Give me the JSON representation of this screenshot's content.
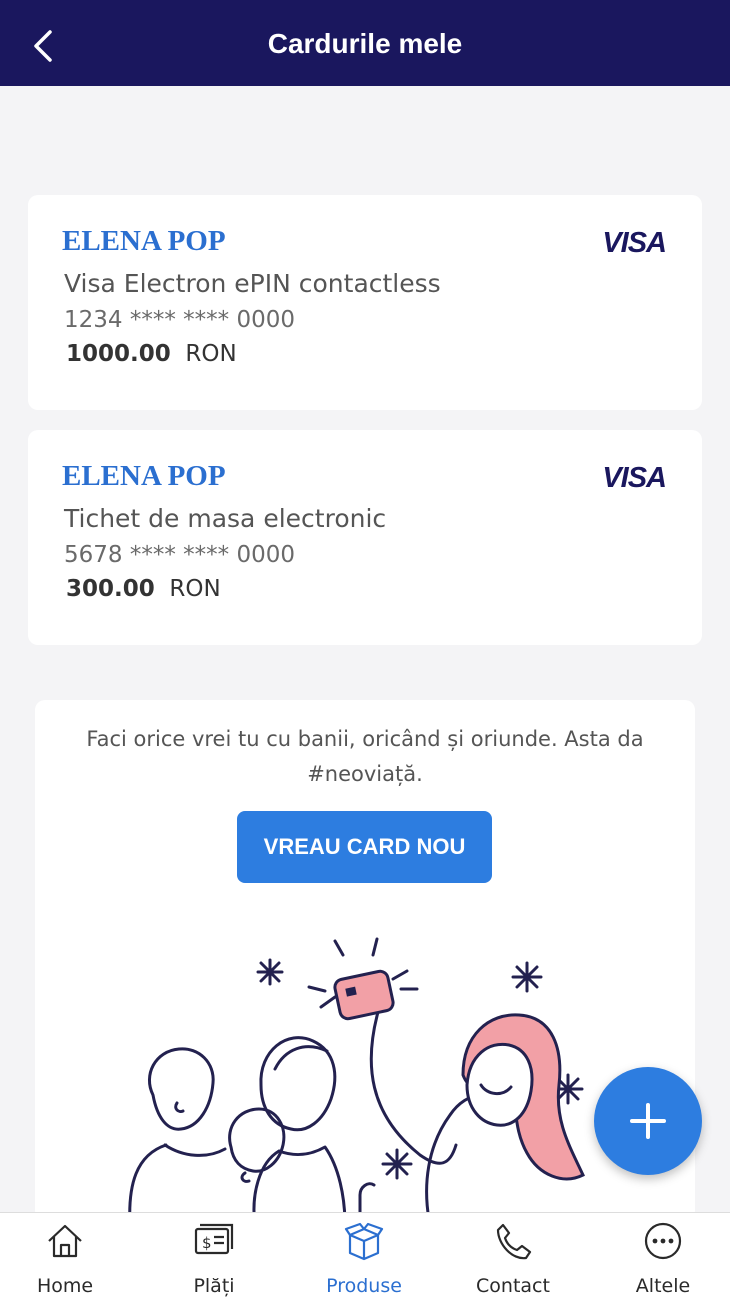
{
  "header": {
    "title": "Cardurile mele"
  },
  "cards": [
    {
      "holder": "ELENA POP",
      "network": "VISA",
      "type": "Visa Electron ePIN contactless",
      "number": "1234 **** **** 0000",
      "balance": "1000.00",
      "currency": "RON"
    },
    {
      "holder": "ELENA POP",
      "network": "VISA",
      "type": "Tichet de masa electronic",
      "number": "5678 **** **** 0000",
      "balance": "300.00",
      "currency": "RON"
    }
  ],
  "promo": {
    "text": "Faci orice vrei tu cu banii, oricând și oriunde. Asta da #neoviață.",
    "button": "VREAU CARD NOU"
  },
  "tabs": [
    {
      "label": "Home",
      "icon": "home-icon"
    },
    {
      "label": "Plăți",
      "icon": "payments-icon"
    },
    {
      "label": "Produse",
      "icon": "box-icon",
      "active": true
    },
    {
      "label": "Contact",
      "icon": "phone-icon"
    },
    {
      "label": "Altele",
      "icon": "more-icon"
    }
  ],
  "colors": {
    "header": "#1a175e",
    "accent": "#2d7de0",
    "holder": "#2b6fd0",
    "illustration_pink": "#f2a0a6",
    "illustration_line": "#23214f"
  }
}
